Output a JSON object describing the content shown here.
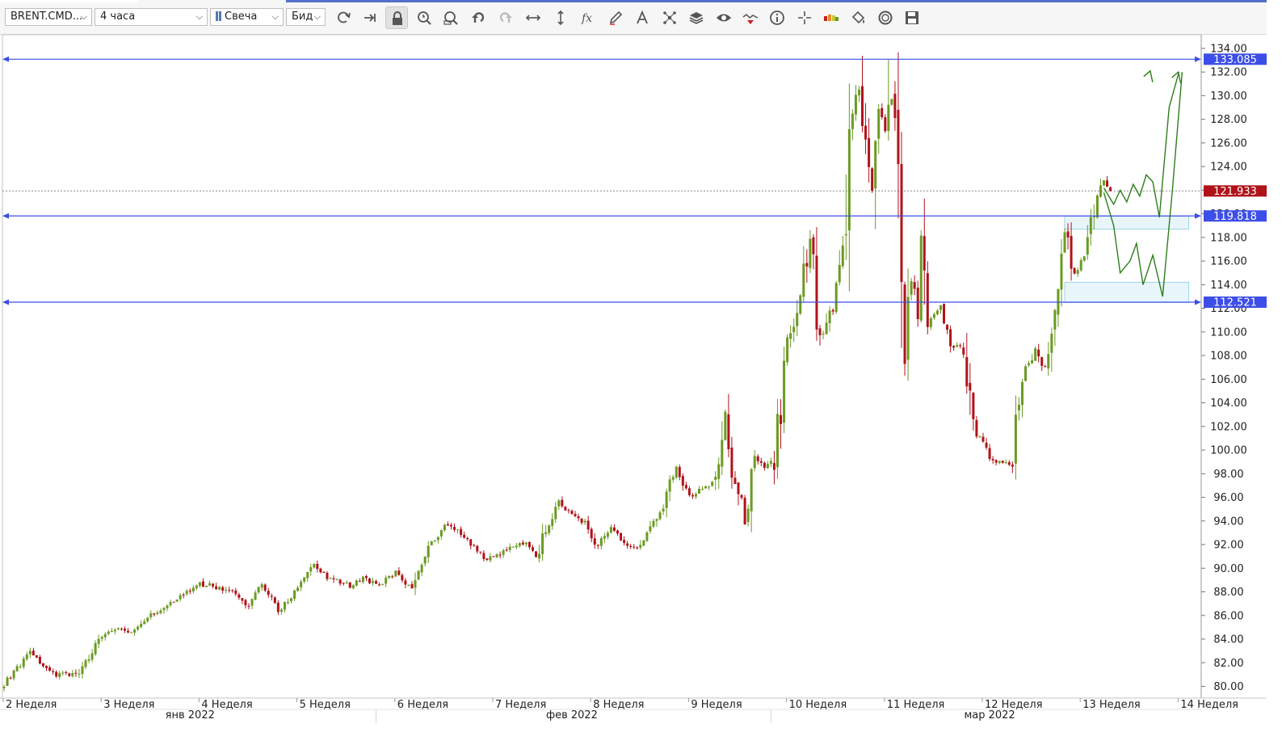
{
  "toolbar": {
    "symbol": "BRENT.CMD...",
    "timeframe": "4 часа",
    "chart_style": "Свеча",
    "price_side": "Бид",
    "icons": [
      "refresh-icon",
      "autoscroll-icon",
      "lock-icon",
      "zoom-time-icon",
      "zoom-box-icon",
      "undo-icon",
      "redo-icon",
      "horizontal-scale-icon",
      "vertical-scale-icon",
      "indicators-fx-icon",
      "pencil-draw-icon",
      "text-tool-icon",
      "pattern-tool-icon",
      "layers-icon",
      "visibility-eye-icon",
      "signal-icon",
      "info-icon",
      "crosshair-icon",
      "sentiment-icon",
      "paint-bucket-icon",
      "fibonacci-circle-icon",
      "save-icon"
    ]
  },
  "colors": {
    "bull": "#6b9a23",
    "bear": "#b0121a",
    "level_line": "#3d4ee8",
    "last_price_bg": "#b0121a",
    "zone_fill": "#e8f6fb",
    "zone_border": "#9fd4e6",
    "forecast": "#2e7d1a"
  },
  "chart_data": {
    "type": "candlestick",
    "symbol": "BRENT.CMD",
    "ylim": [
      78.9,
      134.9
    ],
    "yticks": [
      80,
      82,
      84,
      86,
      88,
      90,
      92,
      94,
      96,
      98,
      100,
      102,
      104,
      106,
      108,
      110,
      112,
      114,
      116,
      118,
      120,
      122,
      124,
      126,
      128,
      130,
      132,
      134
    ],
    "ytick_labels": [
      "80.00",
      "82.00",
      "84.00",
      "86.00",
      "88.00",
      "90.00",
      "92.00",
      "94.00",
      "96.00",
      "98.00",
      "100.00",
      "102.00",
      "104.00",
      "106.00",
      "108.00",
      "110.00",
      "112.00",
      "114.00",
      "116.00",
      "118.00",
      "120.00",
      "122.00",
      "124.00",
      "126.00",
      "128.00",
      "130.00",
      "132.00",
      "134.00"
    ],
    "xlim": [
      0,
      368
    ],
    "week_labels": [
      {
        "label": "2 Неделя",
        "at": 0
      },
      {
        "label": "3 Неделя",
        "at": 30
      },
      {
        "label": "4 Неделя",
        "at": 60
      },
      {
        "label": "5 Неделя",
        "at": 90
      },
      {
        "label": "6 Неделя",
        "at": 120
      },
      {
        "label": "7 Неделя",
        "at": 150
      },
      {
        "label": "8 Неделя",
        "at": 180
      },
      {
        "label": "9 Неделя",
        "at": 210
      },
      {
        "label": "10 Неделя",
        "at": 240
      },
      {
        "label": "11 Неделя",
        "at": 270
      },
      {
        "label": "12 Неделя",
        "at": 300
      },
      {
        "label": "13 Неделя",
        "at": 330
      },
      {
        "label": "14 Неделя",
        "at": 360
      }
    ],
    "month_labels": [
      {
        "label": "янв 2022",
        "at": 57
      },
      {
        "label": "фев 2022",
        "at": 174
      },
      {
        "label": "мар 2022",
        "at": 302
      }
    ],
    "month_separators": [
      114,
      235
    ],
    "horizontal_levels": [
      133.085,
      119.818,
      112.521
    ],
    "level_labels": [
      "133.085",
      "119.818",
      "112.521"
    ],
    "last_price": 121.933,
    "last_price_label": "121.933",
    "zones": [
      {
        "x0": 325,
        "x1": 363,
        "y0": 118.7,
        "y1": 119.8
      },
      {
        "x0": 325,
        "x1": 363,
        "y0": 112.5,
        "y1": 114.2
      }
    ],
    "forecast_paths": [
      [
        [
          337,
          122.2
        ],
        [
          340,
          120.8
        ],
        [
          342,
          122.0
        ],
        [
          344,
          121.0
        ],
        [
          346,
          122.5
        ],
        [
          348,
          121.5
        ],
        [
          350,
          123.3
        ],
        [
          352,
          122.7
        ],
        [
          354,
          119.7
        ],
        [
          357,
          129.0
        ],
        [
          360,
          132.0
        ]
      ],
      [
        [
          337,
          121.8
        ],
        [
          340,
          119.0
        ],
        [
          342,
          115.0
        ],
        [
          345,
          116.0
        ],
        [
          347,
          117.5
        ],
        [
          349,
          114.0
        ],
        [
          352,
          116.5
        ],
        [
          355,
          113.0
        ],
        [
          358,
          122.0
        ],
        [
          361,
          132.0
        ]
      ]
    ],
    "arrow_tips": [
      [
        351.2,
        132.1
      ],
      [
        359.8,
        132.0
      ]
    ],
    "anchors": [
      [
        0,
        80.2
      ],
      [
        8,
        82.8
      ],
      [
        15,
        81.0
      ],
      [
        22,
        80.9
      ],
      [
        30,
        84.2
      ],
      [
        34,
        84.8
      ],
      [
        40,
        84.6
      ],
      [
        45,
        86.0
      ],
      [
        55,
        87.8
      ],
      [
        60,
        88.7
      ],
      [
        70,
        88.1
      ],
      [
        75,
        86.8
      ],
      [
        79,
        88.6
      ],
      [
        84,
        86.4
      ],
      [
        90,
        88.3
      ],
      [
        95,
        90.2
      ],
      [
        100,
        89.0
      ],
      [
        106,
        88.5
      ],
      [
        110,
        89.1
      ],
      [
        115,
        88.6
      ],
      [
        120,
        89.6
      ],
      [
        125,
        88.3
      ],
      [
        130,
        91.9
      ],
      [
        136,
        93.8
      ],
      [
        142,
        92.4
      ],
      [
        147,
        90.8
      ],
      [
        153,
        91.4
      ],
      [
        160,
        92.1
      ],
      [
        163,
        90.9
      ],
      [
        166,
        93.4
      ],
      [
        170,
        95.6
      ],
      [
        174,
        94.5
      ],
      [
        178,
        93.8
      ],
      [
        182,
        91.8
      ],
      [
        186,
        93.6
      ],
      [
        190,
        92.0
      ],
      [
        194,
        91.7
      ],
      [
        198,
        93.5
      ],
      [
        202,
        95.5
      ],
      [
        206,
        98.8
      ],
      [
        210,
        96.1
      ],
      [
        214,
        96.8
      ],
      [
        218,
        97.4
      ],
      [
        221,
        103.1
      ],
      [
        223,
        98.1
      ],
      [
        225,
        96.5
      ],
      [
        227,
        93.6
      ],
      [
        230,
        99.3
      ],
      [
        233,
        98.5
      ],
      [
        236,
        99.2
      ],
      [
        240,
        108.4
      ],
      [
        244,
        113.4
      ],
      [
        247,
        118.0
      ],
      [
        250,
        109.0
      ],
      [
        254,
        112.5
      ],
      [
        258,
        117.7
      ],
      [
        259,
        127.0
      ],
      [
        262,
        130.4
      ],
      [
        264,
        125.0
      ],
      [
        266,
        121.5
      ],
      [
        268,
        128.6
      ],
      [
        270,
        127.2
      ],
      [
        272,
        130.0
      ],
      [
        274,
        125.2
      ],
      [
        276,
        108.2
      ],
      [
        278,
        114.7
      ],
      [
        280,
        112.5
      ],
      [
        281,
        117.9
      ],
      [
        283,
        110.7
      ],
      [
        287,
        112.2
      ],
      [
        290,
        108.9
      ],
      [
        294,
        108.8
      ],
      [
        297,
        101.7
      ],
      [
        300,
        100.6
      ],
      [
        303,
        99.0
      ],
      [
        306,
        99.1
      ],
      [
        309,
        98.6
      ],
      [
        312,
        106.3
      ],
      [
        316,
        108.5
      ],
      [
        319,
        106.8
      ],
      [
        322,
        111.7
      ],
      [
        325,
        118.4
      ],
      [
        328,
        114.9
      ],
      [
        331,
        116.3
      ],
      [
        334,
        120.5
      ],
      [
        337,
        123.0
      ],
      [
        339,
        121.9
      ]
    ],
    "seed": 137
  }
}
